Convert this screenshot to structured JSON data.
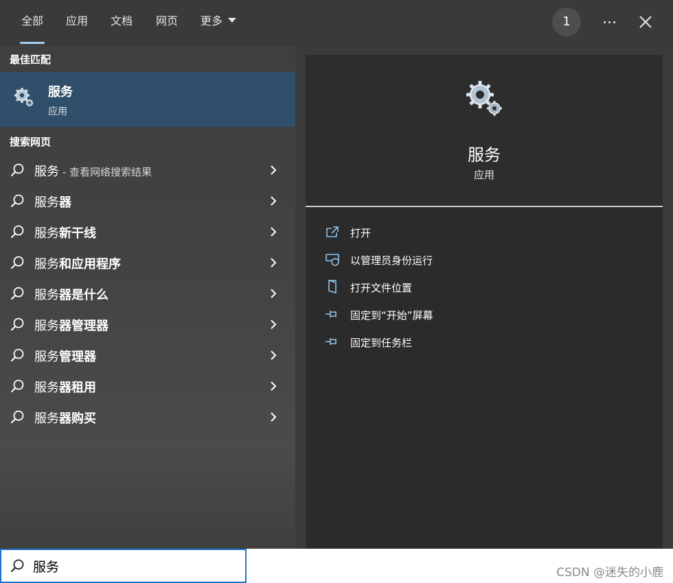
{
  "tabs": [
    "全部",
    "应用",
    "文档",
    "网页",
    "更多"
  ],
  "badge_count": "1",
  "icons": {
    "more": "more-horizontal-icon",
    "close": "close-icon",
    "search": "search-icon",
    "services": "gear-icon",
    "chevron": "chevron-right-icon"
  },
  "left": {
    "best_match_label": "最佳匹配",
    "best_match": {
      "title": "服务",
      "subtitle": "应用"
    },
    "web_label": "搜索网页",
    "web_first": {
      "query": "服务",
      "hint": " - 查看网络搜索结果"
    },
    "suggestions": [
      {
        "prefix": "服务",
        "bold": "器"
      },
      {
        "prefix": "服务",
        "bold": "新干线"
      },
      {
        "prefix": "服务",
        "bold": "和应用程序"
      },
      {
        "prefix": "服务",
        "bold": "器是什么"
      },
      {
        "prefix": "服务",
        "bold": "器管理器"
      },
      {
        "prefix": "服务",
        "bold": "管理器"
      },
      {
        "prefix": "服务",
        "bold": "器租用"
      },
      {
        "prefix": "服务",
        "bold": "器购买"
      }
    ]
  },
  "right": {
    "title": "服务",
    "subtitle": "应用",
    "actions": [
      "打开",
      "以管理员身份运行",
      "打开文件位置",
      "固定到“开始”屏幕",
      "固定到任务栏"
    ]
  },
  "search": {
    "value": "服务"
  },
  "watermark": "CSDN @迷失的小鹿",
  "colors": {
    "selected_bg": "#2f4f6b",
    "accent": "#9fd0f5",
    "search_border": "#1a73c8"
  }
}
